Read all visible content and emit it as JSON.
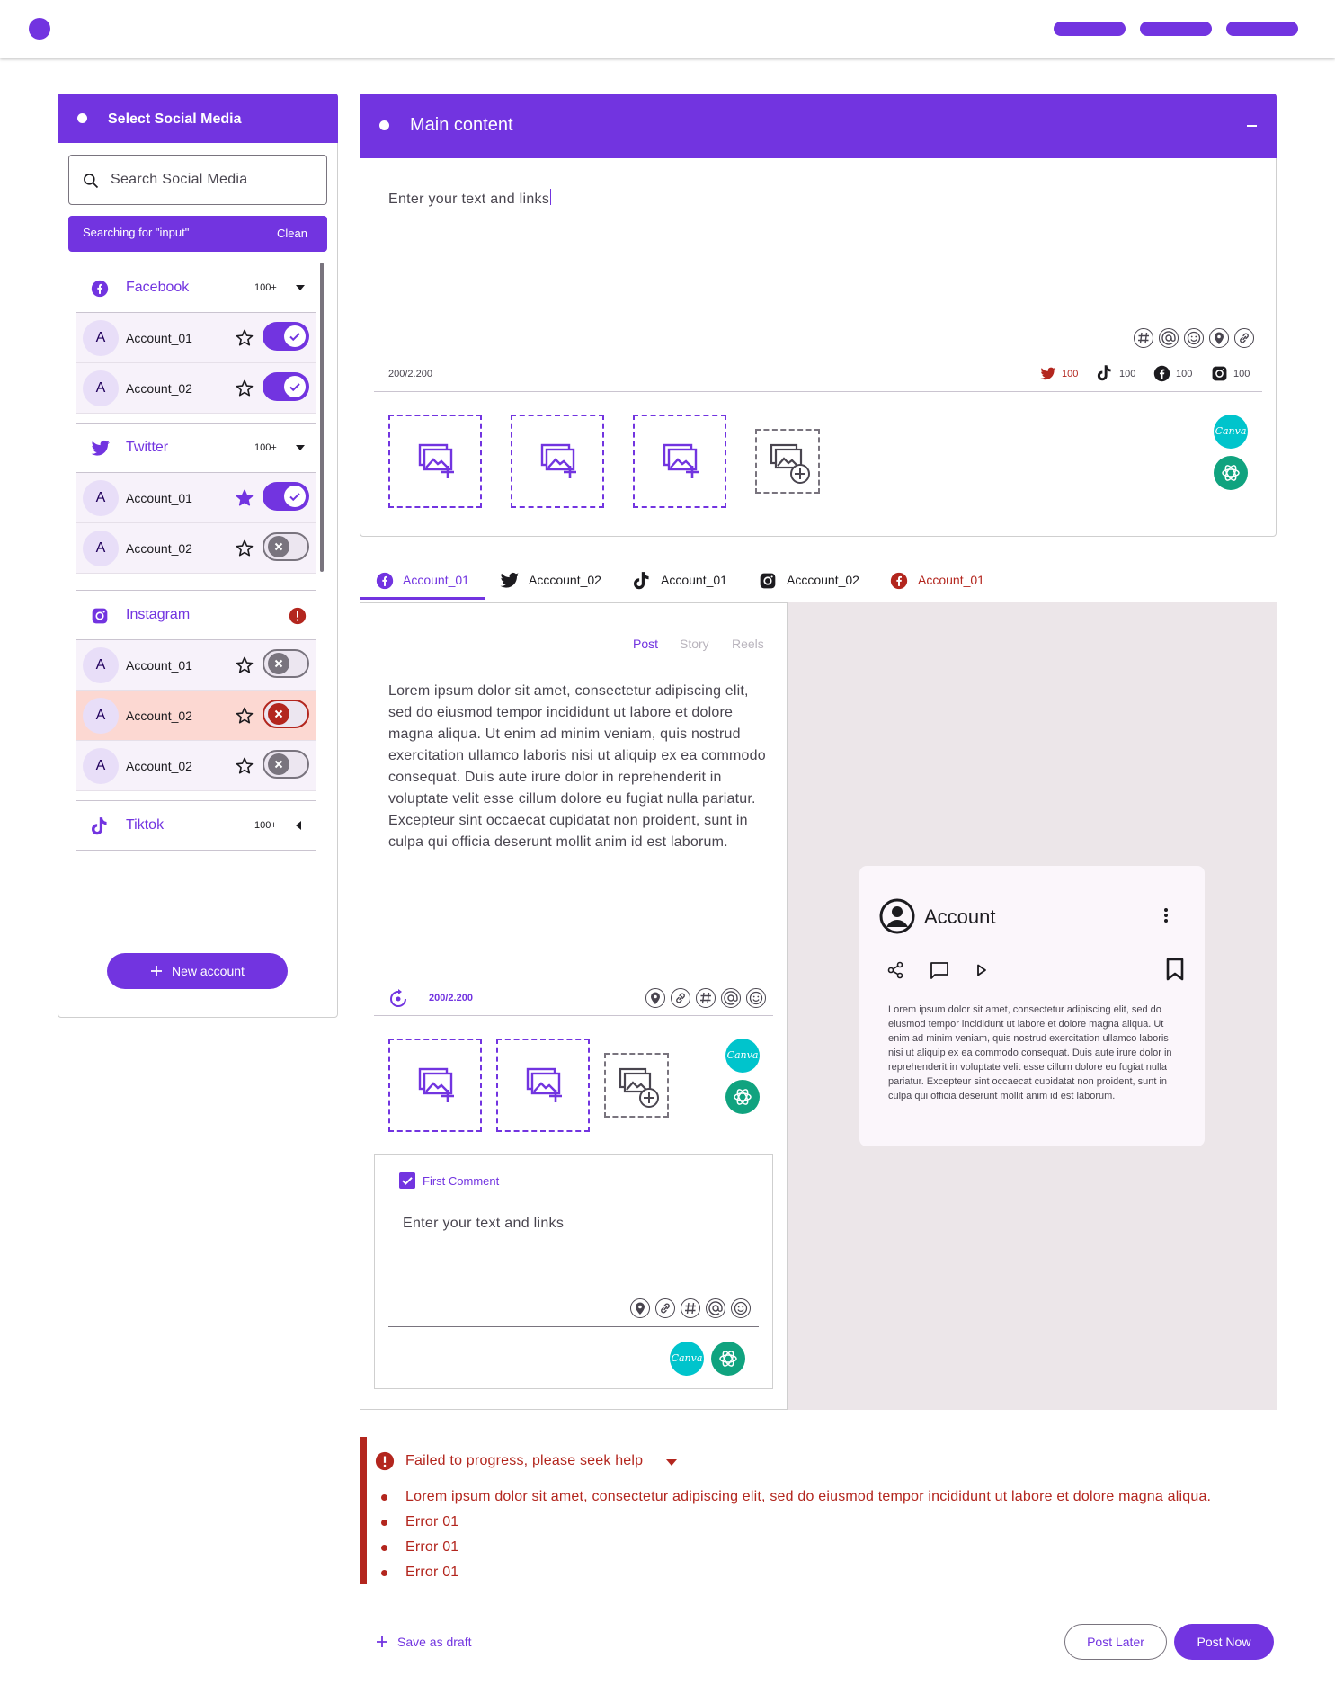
{
  "sidebar": {
    "title": "Select Social Media",
    "search_placeholder": "Search Social Media",
    "searching_label": "Searching for \"input\"",
    "clean_label": "Clean",
    "new_account_label": "New account",
    "groups": [
      {
        "name": "Facebook",
        "count": "100+",
        "accounts": [
          {
            "avatar": "A",
            "name": "Account_01",
            "starred": false,
            "toggle": "on"
          },
          {
            "avatar": "A",
            "name": "Account_02",
            "starred": false,
            "toggle": "on"
          }
        ]
      },
      {
        "name": "Twitter",
        "count": "100+",
        "accounts": [
          {
            "avatar": "A",
            "name": "Account_01",
            "starred": true,
            "toggle": "on"
          },
          {
            "avatar": "A",
            "name": "Account_02",
            "starred": false,
            "toggle": "off"
          }
        ]
      },
      {
        "name": "Instagram",
        "count": "",
        "accounts": [
          {
            "avatar": "A",
            "name": "Account_01",
            "starred": false,
            "toggle": "off"
          },
          {
            "avatar": "A",
            "name": "Account_02",
            "starred": false,
            "toggle": "error"
          },
          {
            "avatar": "A",
            "name": "Account_02",
            "starred": false,
            "toggle": "off"
          }
        ]
      },
      {
        "name": "Tiktok",
        "count": "100+",
        "accounts": []
      }
    ]
  },
  "main": {
    "title": "Main content",
    "placeholder": "Enter your text and links",
    "char_count": "200/2.200",
    "platform_counts": [
      {
        "platform": "twitter-icon",
        "value": "100"
      },
      {
        "platform": "tiktok-icon",
        "value": "100"
      },
      {
        "platform": "facebook-icon",
        "value": "100"
      },
      {
        "platform": "instagram-icon",
        "value": "100"
      }
    ],
    "canva_label": "Canva"
  },
  "tabs": [
    {
      "icon": "facebook-icon",
      "label": "Account_01",
      "state": "active"
    },
    {
      "icon": "twitter-icon",
      "label": "Acccount_02",
      "state": "normal"
    },
    {
      "icon": "tiktok-icon",
      "label": "Account_01",
      "state": "normal"
    },
    {
      "icon": "instagram-icon",
      "label": "Acccount_02",
      "state": "normal"
    },
    {
      "icon": "facebook-icon",
      "label": "Account_01",
      "state": "error"
    }
  ],
  "editor": {
    "post_types": [
      "Post",
      "Story",
      "Reels"
    ],
    "body": "Lorem ipsum dolor sit amet, consectetur adipiscing elit, sed do eiusmod tempor incididunt ut labore et dolore magna aliqua. Ut enim ad minim veniam, quis nostrud exercitation ullamco laboris nisi ut aliquip ex ea commodo consequat. Duis aute irure dolor in reprehenderit in voluptate velit esse cillum dolore eu fugiat nulla pariatur. Excepteur sint occaecat cupidatat non proident, sunt in culpa qui officia deserunt mollit anim id est laborum.",
    "char_count": "200/2.200",
    "first_comment_label": "First Comment",
    "first_comment_placeholder": "Enter your text and links"
  },
  "preview": {
    "account_name": "Account",
    "body": "Lorem ipsum dolor sit amet, consectetur adipiscing elit, sed do eiusmod tempor incididunt ut labore et dolore magna aliqua. Ut enim ad minim veniam, quis nostrud exercitation ullamco laboris nisi ut aliquip ex ea commodo consequat. Duis aute irure dolor in reprehenderit in voluptate velit esse cillum dolore eu fugiat nulla pariatur. Excepteur sint occaecat cupidatat non proident, sunt in culpa qui officia deserunt mollit anim id est laborum."
  },
  "errors": {
    "title": "Failed to progress, please seek help",
    "items": [
      "Lorem ipsum dolor sit amet, consectetur adipiscing elit, sed do eiusmod tempor incididunt ut labore et dolore magna aliqua.",
      "Error 01",
      "Error 01",
      "Error 01"
    ]
  },
  "footer": {
    "save_draft": "Save as draft",
    "post_later": "Post Later",
    "post_now": "Post Now"
  },
  "colors": {
    "primary": "#7234e0",
    "error": "#b3261e",
    "canva": "#00c4cc",
    "chatgpt": "#10a37f"
  }
}
